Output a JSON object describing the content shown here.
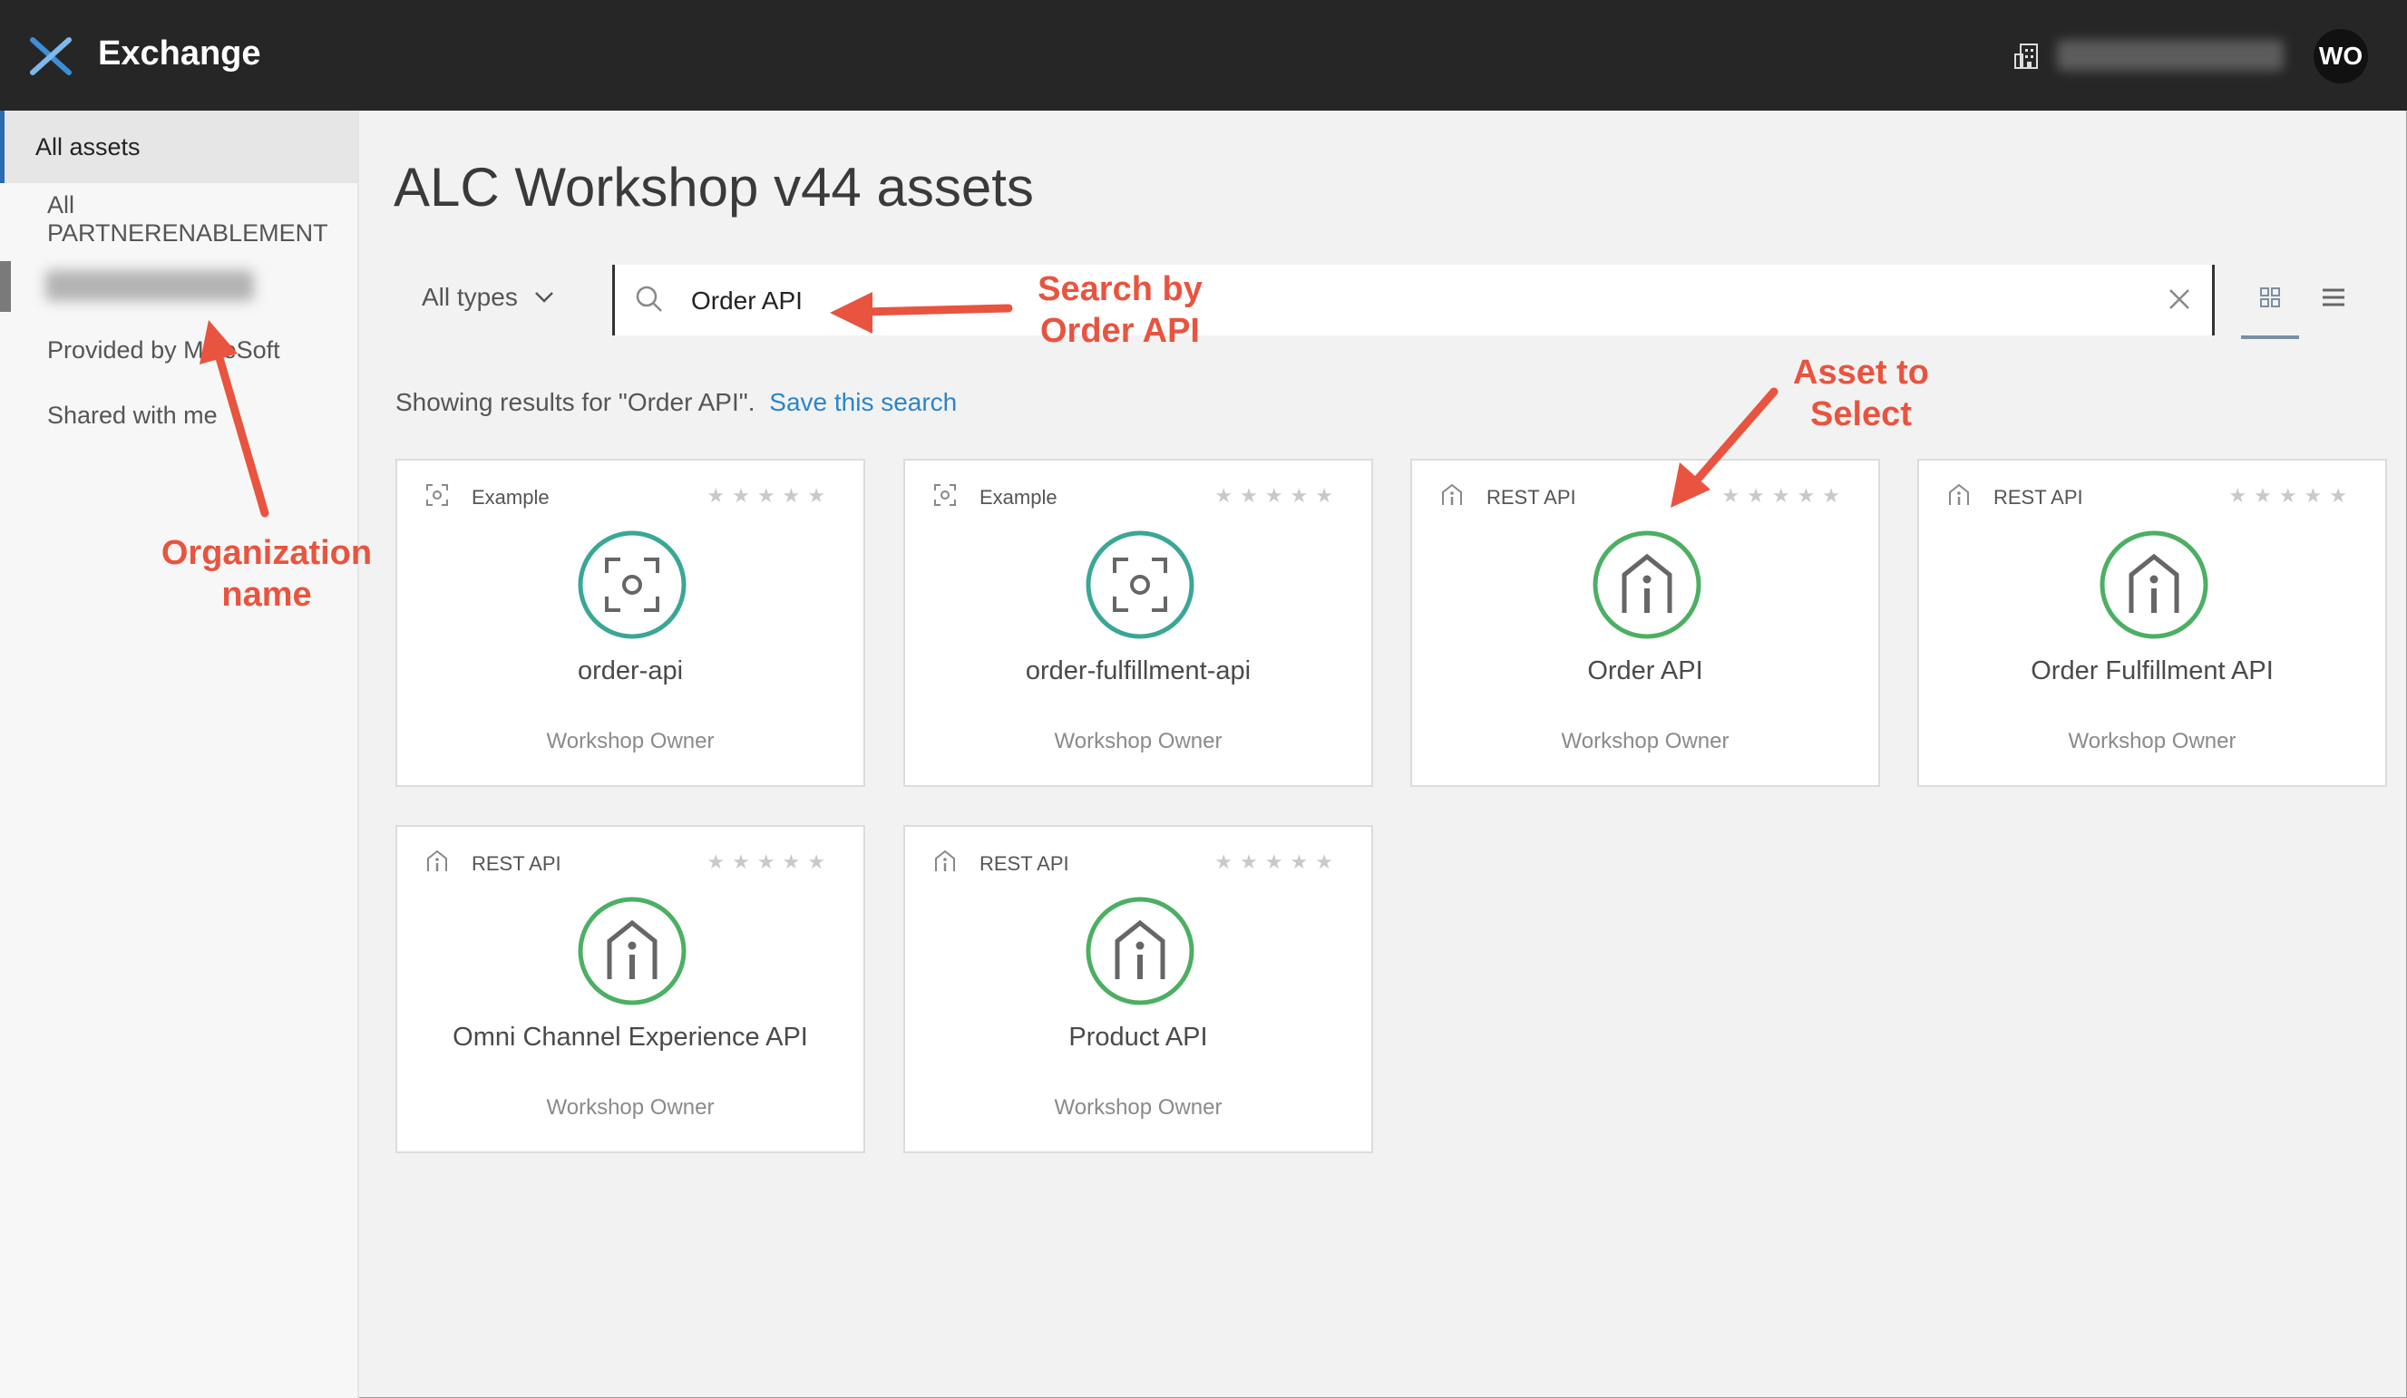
{
  "app": {
    "title": "Exchange",
    "avatar_initials": "WO"
  },
  "sidebar": {
    "items": [
      {
        "label": "All assets"
      },
      {
        "label": "All PARTNERENABLEMENT"
      },
      {
        "label": "Provided by MuleSoft"
      },
      {
        "label": "Shared with me"
      }
    ]
  },
  "main": {
    "title": "ALC Workshop v44 assets",
    "type_filter": "All types",
    "search": {
      "value": "Order API"
    },
    "results_text": "Showing results for \"Order API\".",
    "save_search_label": "Save this search"
  },
  "cards": [
    {
      "type": "Example",
      "name": "order-api",
      "owner": "Workshop Owner",
      "rating": 0
    },
    {
      "type": "Example",
      "name": "order-fulfillment-api",
      "owner": "Workshop Owner",
      "rating": 0
    },
    {
      "type": "REST API",
      "name": "Order API",
      "owner": "Workshop Owner",
      "rating": 0
    },
    {
      "type": "REST API",
      "name": "Order Fulfillment API",
      "owner": "Workshop Owner",
      "rating": 0
    },
    {
      "type": "REST API",
      "name": "Omni Channel Experience API",
      "owner": "Workshop Owner",
      "rating": 0
    },
    {
      "type": "REST API",
      "name": "Product API",
      "owner": "Workshop Owner",
      "rating": 0
    }
  ],
  "annotations": {
    "search_line1": "Search by",
    "search_line2": "Order API",
    "asset_line1": "Asset to",
    "asset_line2": "Select",
    "org_line1": "Organization",
    "org_line2": "name"
  },
  "colors": {
    "topbar": "#262626",
    "accent_blue": "#2b85c8",
    "example_teal": "#3aa796",
    "rest_green": "#4caf63",
    "annotation_red": "#e8543f"
  },
  "icons": {
    "logo": "exchange-logo-icon",
    "building": "building-icon",
    "search": "search-icon",
    "clear": "close-icon",
    "grid": "grid-view-icon",
    "list": "list-view-icon",
    "example": "example-icon",
    "rest": "rest-api-icon"
  }
}
